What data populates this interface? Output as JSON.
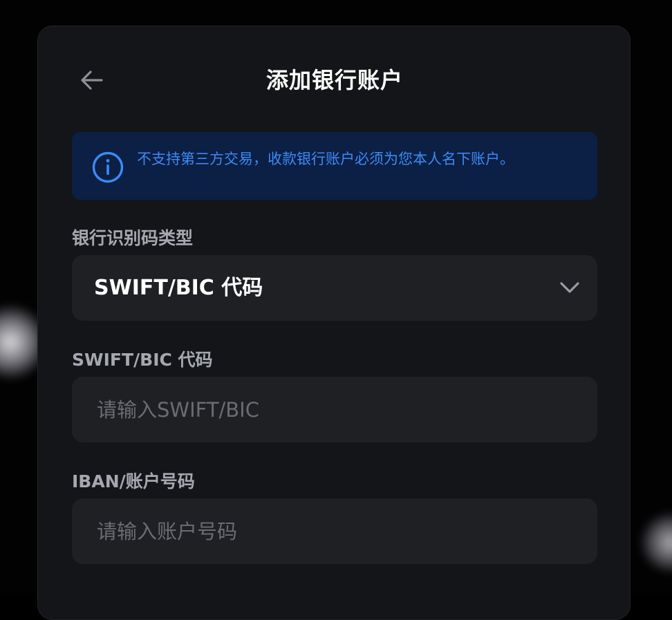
{
  "header": {
    "title": "添加银行账户",
    "back_icon": "arrow-left-icon"
  },
  "notice": {
    "icon": "info-icon",
    "text": "不支持第三方交易，收款银行账户必须为您本人名下账户。",
    "color": "#3c8bf6",
    "background": "#0c1f45"
  },
  "form": {
    "bank_id_type": {
      "label": "银行识别码类型",
      "selected_value": "SWIFT/BIC 代码",
      "icon": "chevron-down-icon"
    },
    "swift_bic": {
      "label": "SWIFT/BIC 代码",
      "value": "",
      "placeholder": "请输入SWIFT/BIC"
    },
    "iban": {
      "label": "IBAN/账户号码",
      "value": "",
      "placeholder": "请输入账户号码"
    }
  },
  "colors": {
    "panel_background": "#141518",
    "field_background": "#1f2024",
    "label_text": "#a6a8b0",
    "placeholder_text": "#6a6c74"
  }
}
